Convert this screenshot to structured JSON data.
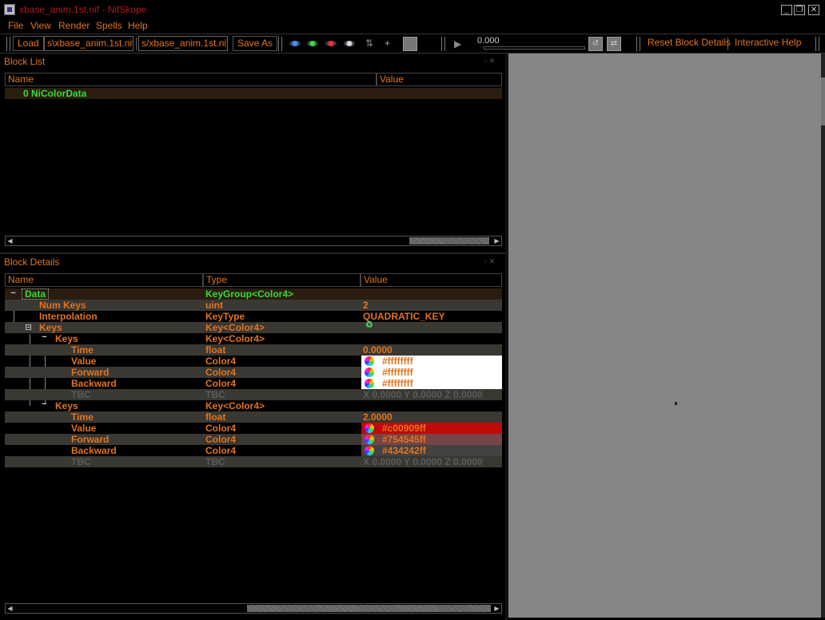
{
  "window": {
    "title": "xbase_anim.1st.nif - NifSkope",
    "title_icon": "nifskope-app-icon",
    "controls": [
      "minimize",
      "restore",
      "close"
    ]
  },
  "menu": {
    "file": "File",
    "view": "View",
    "render": "Render",
    "spells": "Spells",
    "help": "Help"
  },
  "toolbar": {
    "load_label": "Load",
    "load_path": "s\\xbase_anim.1st.nif",
    "save_path": "s/xbase_anim.1st.nif",
    "save_as_label": "Save As",
    "time_value": "0.000",
    "reset_block_details": "Reset Block Details",
    "interactive_help": "Interactive Help",
    "accent": "#e0741e"
  },
  "block_list": {
    "title": "Block List",
    "columns": [
      "Name",
      "Value"
    ],
    "rows": [
      {
        "name": "0 NiColorData",
        "value": ""
      }
    ]
  },
  "block_details": {
    "title": "Block Details",
    "columns": [
      "Name",
      "Type",
      "Value"
    ],
    "rows": [
      {
        "name": "Data",
        "type": "KeyGroup<Color4>",
        "value": ""
      },
      {
        "name": "Num Keys",
        "type": "uint",
        "value": "2"
      },
      {
        "name": "Interpolation",
        "type": "KeyType",
        "value": "QUADRATIC_KEY"
      },
      {
        "name": "Keys",
        "type": "Key<Color4>",
        "value": ""
      },
      {
        "name": "Keys",
        "type": "Key<Color4>",
        "value": ""
      },
      {
        "name": "Time",
        "type": "float",
        "value": "0.0000"
      },
      {
        "name": "Value",
        "type": "Color4",
        "value": "#ffffffff",
        "swatch": "#ffffff"
      },
      {
        "name": "Forward",
        "type": "Color4",
        "value": "#ffffffff",
        "swatch": "#ffffff"
      },
      {
        "name": "Backward",
        "type": "Color4",
        "value": "#ffffffff",
        "swatch": "#ffffff"
      },
      {
        "name": "TBC",
        "type": "TBC",
        "value": "X 0.0000 Y 0.0000 Z 0.0000"
      },
      {
        "name": "Keys",
        "type": "Key<Color4>",
        "value": ""
      },
      {
        "name": "Time",
        "type": "float",
        "value": "2.0000"
      },
      {
        "name": "Value",
        "type": "Color4",
        "value": "#c00909ff",
        "swatch": "#c00909"
      },
      {
        "name": "Forward",
        "type": "Color4",
        "value": "#754545ff",
        "swatch": "#754545"
      },
      {
        "name": "Backward",
        "type": "Color4",
        "value": "#434242ff",
        "swatch": "#434242"
      },
      {
        "name": "TBC",
        "type": "TBC",
        "value": "X 0.0000 Y 0.0000 Z 0.0000"
      }
    ]
  },
  "colors": {
    "name_green": "#33dd33",
    "text_orange": "#e0741e",
    "title_red": "#b01818",
    "viewport_gray": "#868686"
  }
}
